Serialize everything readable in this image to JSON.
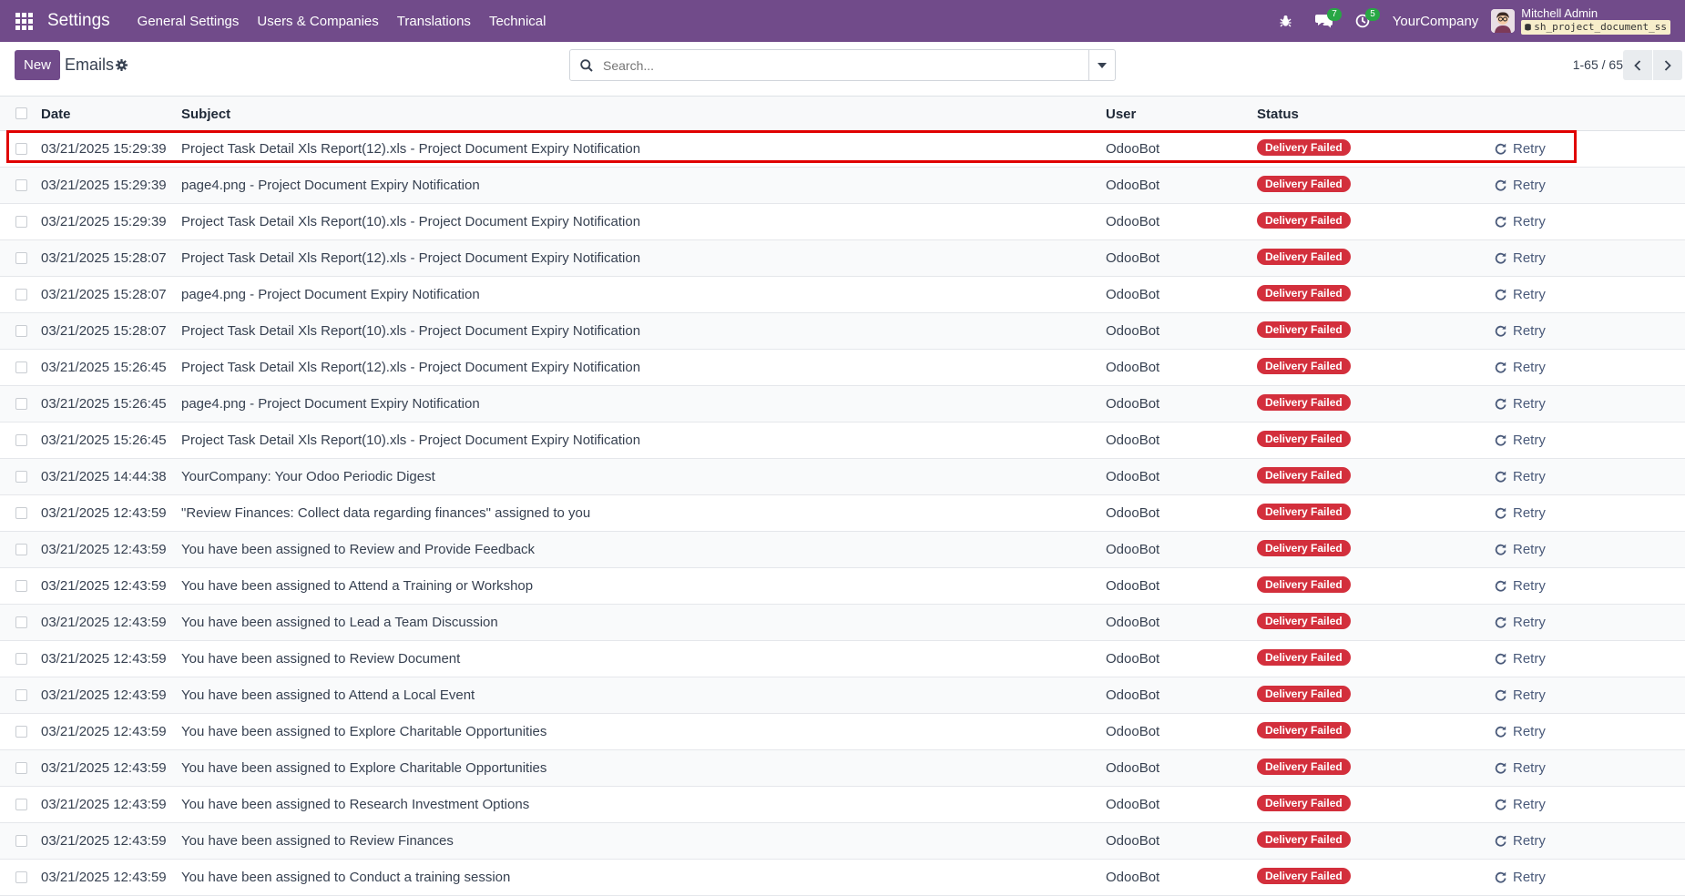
{
  "navbar": {
    "app_name": "Settings",
    "menu": [
      "General Settings",
      "Users & Companies",
      "Translations",
      "Technical"
    ],
    "messages_count": "7",
    "activities_count": "5",
    "company": "YourCompany",
    "user_name": "Mitchell Admin",
    "database": "sh_project_document_ss",
    "accent_color": "#714b8a"
  },
  "control_panel": {
    "new_label": "New",
    "title": "Emails",
    "search_placeholder": "Search...",
    "pager": "1-65 / 65"
  },
  "list": {
    "columns": {
      "date": "Date",
      "subject": "Subject",
      "user": "User",
      "status": "Status"
    },
    "action_label": "Retry",
    "rows": [
      {
        "date": "03/21/2025 15:29:39",
        "subject": "Project Task Detail Xls Report(12).xls - Project Document Expiry Notification",
        "user": "OdooBot",
        "status": "Delivery Failed"
      },
      {
        "date": "03/21/2025 15:29:39",
        "subject": "page4.png - Project Document Expiry Notification",
        "user": "OdooBot",
        "status": "Delivery Failed"
      },
      {
        "date": "03/21/2025 15:29:39",
        "subject": "Project Task Detail Xls Report(10).xls - Project Document Expiry Notification",
        "user": "OdooBot",
        "status": "Delivery Failed"
      },
      {
        "date": "03/21/2025 15:28:07",
        "subject": "Project Task Detail Xls Report(12).xls - Project Document Expiry Notification",
        "user": "OdooBot",
        "status": "Delivery Failed"
      },
      {
        "date": "03/21/2025 15:28:07",
        "subject": "page4.png - Project Document Expiry Notification",
        "user": "OdooBot",
        "status": "Delivery Failed"
      },
      {
        "date": "03/21/2025 15:28:07",
        "subject": "Project Task Detail Xls Report(10).xls - Project Document Expiry Notification",
        "user": "OdooBot",
        "status": "Delivery Failed"
      },
      {
        "date": "03/21/2025 15:26:45",
        "subject": "Project Task Detail Xls Report(12).xls - Project Document Expiry Notification",
        "user": "OdooBot",
        "status": "Delivery Failed"
      },
      {
        "date": "03/21/2025 15:26:45",
        "subject": "page4.png - Project Document Expiry Notification",
        "user": "OdooBot",
        "status": "Delivery Failed"
      },
      {
        "date": "03/21/2025 15:26:45",
        "subject": "Project Task Detail Xls Report(10).xls - Project Document Expiry Notification",
        "user": "OdooBot",
        "status": "Delivery Failed"
      },
      {
        "date": "03/21/2025 14:44:38",
        "subject": "YourCompany: Your Odoo Periodic Digest",
        "user": "OdooBot",
        "status": "Delivery Failed"
      },
      {
        "date": "03/21/2025 12:43:59",
        "subject": "\"Review Finances: Collect data regarding finances\" assigned to you",
        "user": "OdooBot",
        "status": "Delivery Failed"
      },
      {
        "date": "03/21/2025 12:43:59",
        "subject": "You have been assigned to Review and Provide Feedback",
        "user": "OdooBot",
        "status": "Delivery Failed"
      },
      {
        "date": "03/21/2025 12:43:59",
        "subject": "You have been assigned to Attend a Training or Workshop",
        "user": "OdooBot",
        "status": "Delivery Failed"
      },
      {
        "date": "03/21/2025 12:43:59",
        "subject": "You have been assigned to Lead a Team Discussion",
        "user": "OdooBot",
        "status": "Delivery Failed"
      },
      {
        "date": "03/21/2025 12:43:59",
        "subject": "You have been assigned to Review Document",
        "user": "OdooBot",
        "status": "Delivery Failed"
      },
      {
        "date": "03/21/2025 12:43:59",
        "subject": "You have been assigned to Attend a Local Event",
        "user": "OdooBot",
        "status": "Delivery Failed"
      },
      {
        "date": "03/21/2025 12:43:59",
        "subject": "You have been assigned to Explore Charitable Opportunities",
        "user": "OdooBot",
        "status": "Delivery Failed"
      },
      {
        "date": "03/21/2025 12:43:59",
        "subject": "You have been assigned to Explore Charitable Opportunities",
        "user": "OdooBot",
        "status": "Delivery Failed"
      },
      {
        "date": "03/21/2025 12:43:59",
        "subject": "You have been assigned to Research Investment Options",
        "user": "OdooBot",
        "status": "Delivery Failed"
      },
      {
        "date": "03/21/2025 12:43:59",
        "subject": "You have been assigned to Review Finances",
        "user": "OdooBot",
        "status": "Delivery Failed"
      },
      {
        "date": "03/21/2025 12:43:59",
        "subject": "You have been assigned to Conduct a training session",
        "user": "OdooBot",
        "status": "Delivery Failed"
      }
    ]
  }
}
